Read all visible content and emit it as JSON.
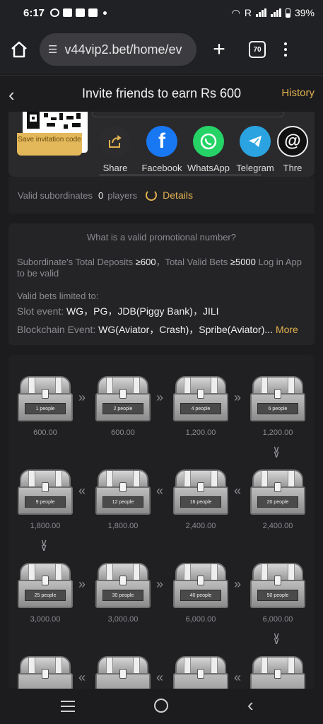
{
  "status": {
    "time": "6:17",
    "battery": "39%",
    "carrier_letter": "R"
  },
  "browser": {
    "url": "v44vip2.bet/home/ev",
    "tab_count": "70",
    "home_icon": "home-icon",
    "new_tab_icon": "plus-icon",
    "menu_icon": "kebab-icon"
  },
  "header": {
    "title": "Invite friends to earn Rs 600",
    "history": "History",
    "back_icon": "chevron-left-icon"
  },
  "share": {
    "save_invitation": "Save invitation code",
    "items": [
      {
        "label": "Share",
        "icon": "share-icon",
        "color": "#2c2c2f"
      },
      {
        "label": "Facebook",
        "icon": "facebook-icon",
        "color": "#1877f2"
      },
      {
        "label": "WhatsApp",
        "icon": "whatsapp-icon",
        "color": "#25d366"
      },
      {
        "label": "Telegram",
        "icon": "telegram-icon",
        "color": "#2aa3e0"
      },
      {
        "label": "Thre",
        "icon": "threads-icon",
        "color": "#111111"
      }
    ]
  },
  "valid": {
    "label": "Valid subordinates",
    "count": "0",
    "unit": "players",
    "details": "Details"
  },
  "info": {
    "question": "What is a valid promotional number?",
    "rule_a": "Subordinate's Total Deposits ",
    "rule_a_val": "≥600",
    "rule_b": "，Total Valid Bets ",
    "rule_b_val": "≥5000",
    "rule_c": " Log in App to be valid",
    "limited": "Valid bets limited to:",
    "slot_label": "Slot event: ",
    "slot_value": "WG，PG，JDB(Piggy Bank)，JILI",
    "chain_label": "Blockchain Event: ",
    "chain_value": "WG(Aviator，Crash)，Spribe(Aviator)...",
    "more": "More"
  },
  "chests": [
    {
      "people": "1 people",
      "amount": "600.00"
    },
    {
      "people": "2 people",
      "amount": "600.00"
    },
    {
      "people": "4 people",
      "amount": "1,200.00"
    },
    {
      "people": "6 people",
      "amount": "1,200.00"
    },
    {
      "people": "20 people",
      "amount": "2,400.00"
    },
    {
      "people": "16 people",
      "amount": "2,400.00"
    },
    {
      "people": "12 people",
      "amount": "1,800.00"
    },
    {
      "people": "9 people",
      "amount": "1,800.00"
    },
    {
      "people": "25 people",
      "amount": "3,000.00"
    },
    {
      "people": "30 people",
      "amount": "3,000.00"
    },
    {
      "people": "40 people",
      "amount": "6,000.00"
    },
    {
      "people": "50 people",
      "amount": "6,000.00"
    }
  ],
  "accent": "#e2b24e"
}
